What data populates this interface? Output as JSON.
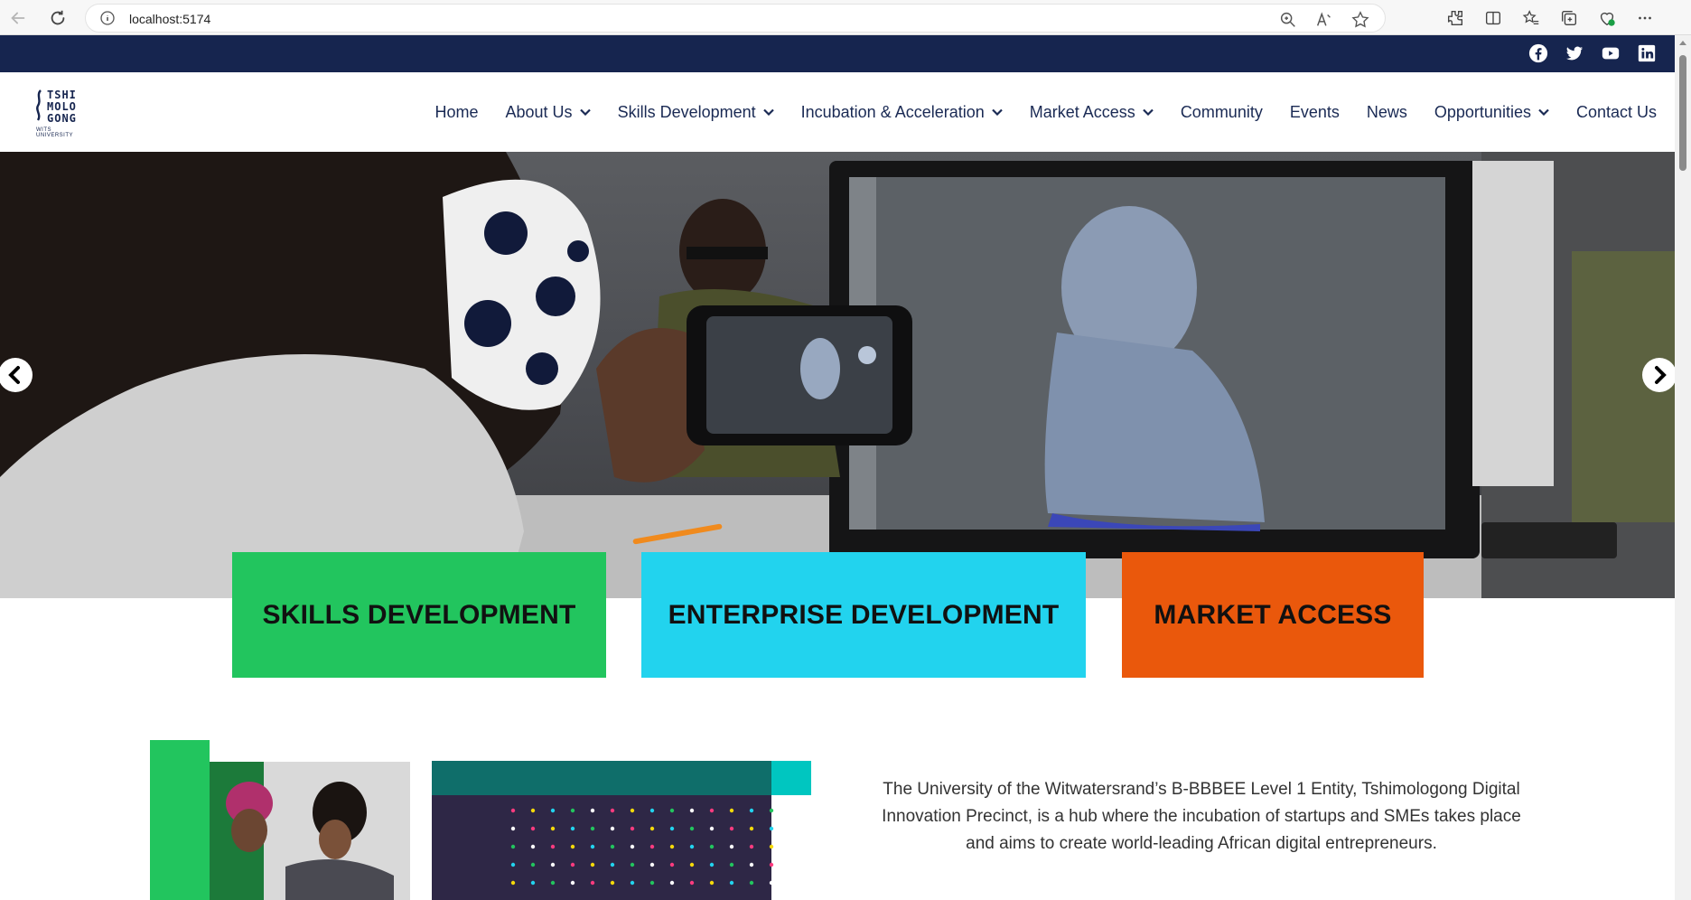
{
  "browser": {
    "url": "localhost:5174"
  },
  "social": [
    "facebook-icon",
    "twitter-icon",
    "youtube-icon",
    "linkedin-icon"
  ],
  "logo": {
    "lines": [
      "TSHI",
      "MOLO",
      "GONG"
    ],
    "subtitle": "WITS UNIVERSITY"
  },
  "nav": {
    "items": [
      {
        "label": "Home",
        "dropdown": false
      },
      {
        "label": "About Us",
        "dropdown": true
      },
      {
        "label": "Skills Development",
        "dropdown": true
      },
      {
        "label": "Incubation & Acceleration",
        "dropdown": true
      },
      {
        "label": "Market Access",
        "dropdown": true
      },
      {
        "label": "Community",
        "dropdown": false
      },
      {
        "label": "Events",
        "dropdown": false
      },
      {
        "label": "News",
        "dropdown": false
      },
      {
        "label": "Opportunities",
        "dropdown": true
      },
      {
        "label": "Contact Us",
        "dropdown": false
      }
    ]
  },
  "tiles": [
    {
      "label": "SKILLS DEVELOPMENT",
      "color": "#22c55e"
    },
    {
      "label": "ENTERPRISE DEVELOPMENT",
      "color": "#22d3ee"
    },
    {
      "label": "MARKET ACCESS",
      "color": "#ea580c"
    }
  ],
  "intro": {
    "text": "The University of the Witwatersrand’s B-BBBEE Level 1 Entity, Tshimologong Digital Innovation Precinct, is a hub where the incubation of startups and SMEs takes place and aims to create world-leading African digital entrepreneurs."
  },
  "colors": {
    "topbar": "#16254f",
    "nav_text": "#1a2a54"
  }
}
